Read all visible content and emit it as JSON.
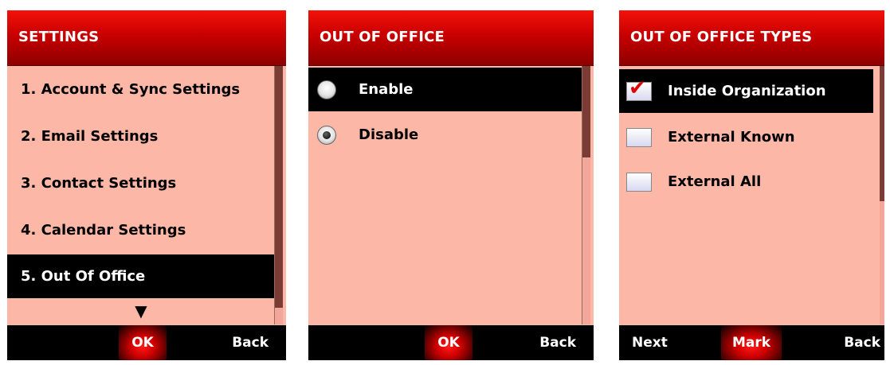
{
  "settings": {
    "title": "SETTINGS",
    "items": [
      {
        "label": "1. Account & Sync Settings"
      },
      {
        "label": "2. Email Settings"
      },
      {
        "label": "3. Contact Settings"
      },
      {
        "label": "4. Calendar Settings"
      },
      {
        "label": "5. Out Of Office"
      }
    ],
    "more_indicator": "▼",
    "softkeys": {
      "center": "OK",
      "right": "Back"
    }
  },
  "out_of_office": {
    "title": "OUT OF OFFICE",
    "options": [
      {
        "label": "Enable",
        "selected": false
      },
      {
        "label": "Disable",
        "selected": true
      }
    ],
    "softkeys": {
      "center": "OK",
      "right": "Back"
    }
  },
  "out_of_office_types": {
    "title": "OUT OF OFFICE TYPES",
    "options": [
      {
        "label": "Inside Organization",
        "checked": true
      },
      {
        "label": "External Known",
        "checked": false
      },
      {
        "label": "External All",
        "checked": false
      }
    ],
    "check_glyph": "✔",
    "softkeys": {
      "left": "Next",
      "center": "Mark",
      "right": "Back"
    }
  },
  "colors": {
    "title_red": "#c80000",
    "list_background": "#fdb7a6",
    "highlight": "#000000",
    "softkey_bar": "#000000"
  }
}
